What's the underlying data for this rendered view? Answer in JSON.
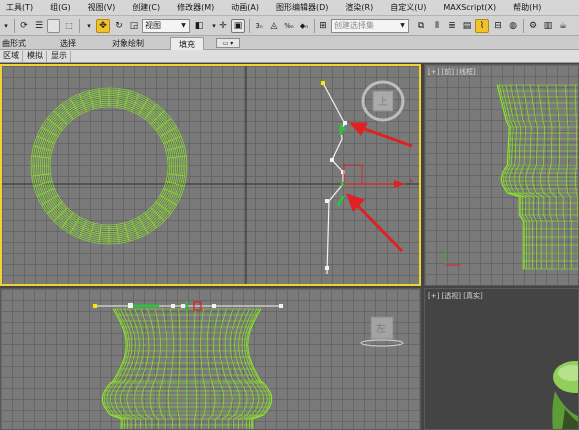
{
  "menubar": {
    "items": [
      "工具(T)",
      "组(G)",
      "视图(V)",
      "创建(C)",
      "修改器(M)",
      "动画(A)",
      "图形编辑器(D)",
      "渲染(R)",
      "自定义(U)",
      "MAXScript(X)",
      "帮助(H)"
    ]
  },
  "toolbar": {
    "view_dropdown": "视图",
    "selection_set_placeholder": "创建选择集"
  },
  "ribbon": {
    "tabs": [
      "曲形式",
      "选择",
      "对象绘制",
      "填充"
    ],
    "active_tab": "填充"
  },
  "subrow": {
    "items": [
      "区域",
      "模拟",
      "显示"
    ]
  },
  "viewports": {
    "top_left": {
      "label": ""
    },
    "top_right": {
      "label": "[+] [前] [线框]"
    },
    "bottom_left": {
      "label": ""
    },
    "bottom_right": {
      "label": "[+] [透视] [真实]"
    }
  },
  "viewcube": {
    "top": "上",
    "left": "左"
  },
  "axis": {
    "x": "x"
  },
  "colors": {
    "wire": "#8cf01e",
    "active_border": "#f0d232",
    "spline_white": "#f2f2f2",
    "arrow_red": "#e02121",
    "gizmo_yellow": "#ffe600",
    "teapot_green": "#8fcf5a"
  }
}
